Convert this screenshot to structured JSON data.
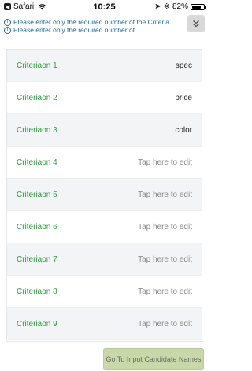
{
  "status_bar": {
    "back_app": "Safari",
    "time": "10:25",
    "battery_text": "82%",
    "battery_level": 0.82
  },
  "notes": [
    "Please enter only the required number of the Criteria",
    "Please enter only the required number of"
  ],
  "criteria": [
    {
      "label": "Criteriaon 1",
      "value": "spec",
      "filled": true
    },
    {
      "label": "Criteriaon 2",
      "value": "price",
      "filled": true
    },
    {
      "label": "Criteriaon 3",
      "value": "color",
      "filled": true
    },
    {
      "label": "Criteriaon 4",
      "value": "Tap here to edit",
      "filled": false
    },
    {
      "label": "Criteriaon 5",
      "value": "Tap here to edit",
      "filled": false
    },
    {
      "label": "Criteriaon 6",
      "value": "Tap here to edit",
      "filled": false
    },
    {
      "label": "Criteriaon 7",
      "value": "Tap here to edit",
      "filled": false
    },
    {
      "label": "Criteriaon 8",
      "value": "Tap here to edit",
      "filled": false
    },
    {
      "label": "Criteriaon 9",
      "value": "Tap here to edit",
      "filled": false
    }
  ],
  "actions": {
    "go_button": "Go To Input Candidate Names"
  },
  "colors": {
    "criteria_label": "#2e9b3f",
    "note_text": "#1d6aa3",
    "button_bg": "#c8d8a8"
  }
}
